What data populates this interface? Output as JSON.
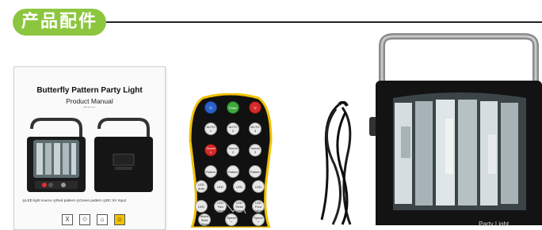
{
  "header": {
    "title": "产品配件"
  },
  "manual": {
    "title": "Butterfly Pattern Party Light",
    "subtitle": "Product Manual",
    "caption": "◎LED light source  ◎Red pattern  ◎Green pattern  ◎DC 5V Input",
    "icons": [
      "X",
      "♲",
      "⌂",
      "☺"
    ]
  },
  "remote": {
    "buttons": [
      {
        "label": "⏻",
        "color": "blue"
      },
      {
        "label": "Flash",
        "color": "green"
      },
      {
        "label": "⏻",
        "color": "red"
      },
      {
        "label": "AUTO 1",
        "color": "gray"
      },
      {
        "label": "AUTO 2",
        "color": "gray"
      },
      {
        "label": "AUTO 3",
        "color": "gray"
      },
      {
        "label": "Sound 1",
        "color": "red"
      },
      {
        "label": "Sound 2",
        "color": "gray"
      },
      {
        "label": "Sound 3",
        "color": "gray"
      },
      {
        "label": "Pattern",
        "color": "gray"
      },
      {
        "label": "Pattern",
        "color": "gray"
      },
      {
        "label": "Pattern",
        "color": "gray"
      },
      {
        "label": "LED Auto",
        "color": "gray"
      },
      {
        "label": "LED",
        "color": "gray"
      },
      {
        "label": "LED",
        "color": "gray"
      },
      {
        "label": "LED",
        "color": "gray"
      },
      {
        "label": "LED",
        "color": "gray"
      },
      {
        "label": "LED Two Colors",
        "color": "gray"
      },
      {
        "label": "LED Three Colors",
        "color": "gray"
      },
      {
        "label": "LED Four Colors",
        "color": "gray"
      },
      {
        "label": "Motor Start Stop",
        "color": "gray"
      },
      {
        "label": "Speed −",
        "color": "gray"
      },
      {
        "label": "Speed +",
        "color": "gray"
      }
    ]
  },
  "device": {
    "brand": "Party Light"
  },
  "colors": {
    "accent": "#8cc63f",
    "line": "#222222",
    "remote_body": "#111111",
    "remote_trim": "#f2c100"
  }
}
